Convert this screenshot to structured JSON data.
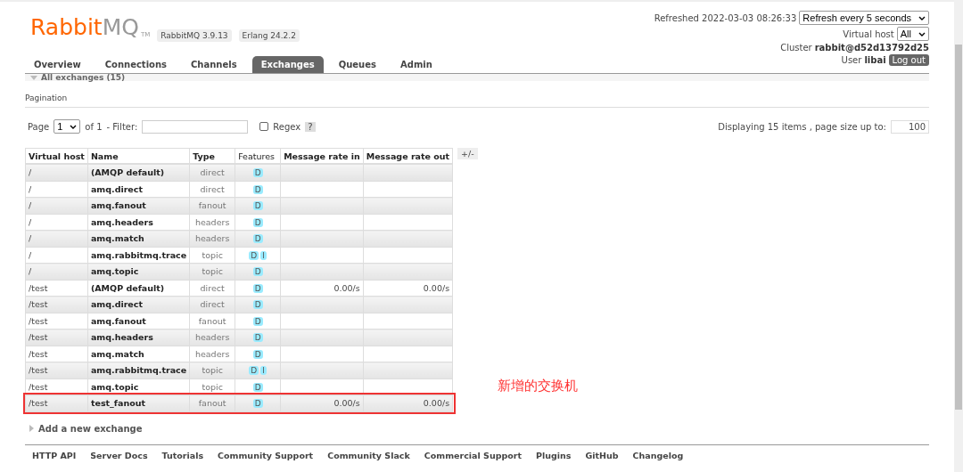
{
  "header": {
    "logo_text": {
      "brand": "Rabbit",
      "suffix": "MQ",
      "mark": "TM"
    },
    "badges": [
      "RabbitMQ 3.9.13",
      "Erlang 24.2.2"
    ],
    "refreshed_label": "Refreshed 2022-03-03 08:26:33",
    "refresh_select": "Refresh every 5 seconds",
    "vhost_label": "Virtual host",
    "vhost_select": "All",
    "cluster_label": "Cluster",
    "cluster_value": "rabbit@d52d13792d25",
    "user_label": "User",
    "user_value": "libai",
    "logout": "Log out"
  },
  "tabs": [
    {
      "label": "Overview",
      "selected": false
    },
    {
      "label": "Connections",
      "selected": false
    },
    {
      "label": "Channels",
      "selected": false
    },
    {
      "label": "Exchanges",
      "selected": true
    },
    {
      "label": "Queues",
      "selected": false
    },
    {
      "label": "Admin",
      "selected": false
    }
  ],
  "section": {
    "title": "All exchanges (15)",
    "expanded": true
  },
  "pagination": {
    "heading": "Pagination",
    "page_label": "Page",
    "page_select": "1",
    "of_label": "of 1",
    "filter_label": "- Filter:",
    "regex_label": "Regex",
    "regex_checked": false,
    "help": "?",
    "displaying": "Displaying 15 items , page size up to:",
    "page_size": "100"
  },
  "table": {
    "columns": [
      "Virtual host",
      "Name",
      "Type",
      "Features",
      "Message rate in",
      "Message rate out"
    ],
    "column_toggle": "+/-",
    "rows": [
      {
        "vhost": "/",
        "name": "(AMQP default)",
        "type": "direct",
        "features": [
          "D"
        ],
        "rate_in": "",
        "rate_out": "",
        "highlighted": false
      },
      {
        "vhost": "/",
        "name": "amq.direct",
        "type": "direct",
        "features": [
          "D"
        ],
        "rate_in": "",
        "rate_out": "",
        "highlighted": false
      },
      {
        "vhost": "/",
        "name": "amq.fanout",
        "type": "fanout",
        "features": [
          "D"
        ],
        "rate_in": "",
        "rate_out": "",
        "highlighted": false
      },
      {
        "vhost": "/",
        "name": "amq.headers",
        "type": "headers",
        "features": [
          "D"
        ],
        "rate_in": "",
        "rate_out": "",
        "highlighted": false
      },
      {
        "vhost": "/",
        "name": "amq.match",
        "type": "headers",
        "features": [
          "D"
        ],
        "rate_in": "",
        "rate_out": "",
        "highlighted": false
      },
      {
        "vhost": "/",
        "name": "amq.rabbitmq.trace",
        "type": "topic",
        "features": [
          "D",
          "I"
        ],
        "rate_in": "",
        "rate_out": "",
        "highlighted": false
      },
      {
        "vhost": "/",
        "name": "amq.topic",
        "type": "topic",
        "features": [
          "D"
        ],
        "rate_in": "",
        "rate_out": "",
        "highlighted": false
      },
      {
        "vhost": "/test",
        "name": "(AMQP default)",
        "type": "direct",
        "features": [
          "D"
        ],
        "rate_in": "0.00/s",
        "rate_out": "0.00/s",
        "highlighted": false
      },
      {
        "vhost": "/test",
        "name": "amq.direct",
        "type": "direct",
        "features": [
          "D"
        ],
        "rate_in": "",
        "rate_out": "",
        "highlighted": false
      },
      {
        "vhost": "/test",
        "name": "amq.fanout",
        "type": "fanout",
        "features": [
          "D"
        ],
        "rate_in": "",
        "rate_out": "",
        "highlighted": false
      },
      {
        "vhost": "/test",
        "name": "amq.headers",
        "type": "headers",
        "features": [
          "D"
        ],
        "rate_in": "",
        "rate_out": "",
        "highlighted": false
      },
      {
        "vhost": "/test",
        "name": "amq.match",
        "type": "headers",
        "features": [
          "D"
        ],
        "rate_in": "",
        "rate_out": "",
        "highlighted": false
      },
      {
        "vhost": "/test",
        "name": "amq.rabbitmq.trace",
        "type": "topic",
        "features": [
          "D",
          "I"
        ],
        "rate_in": "",
        "rate_out": "",
        "highlighted": false
      },
      {
        "vhost": "/test",
        "name": "amq.topic",
        "type": "topic",
        "features": [
          "D"
        ],
        "rate_in": "",
        "rate_out": "",
        "highlighted": false
      },
      {
        "vhost": "/test",
        "name": "test_fanout",
        "type": "fanout",
        "features": [
          "D"
        ],
        "rate_in": "0.00/s",
        "rate_out": "0.00/s",
        "highlighted": true
      }
    ]
  },
  "annotation": "新增的交换机",
  "add_section": {
    "title": "Add a new exchange",
    "expanded": false
  },
  "footer": [
    "HTTP API",
    "Server Docs",
    "Tutorials",
    "Community Support",
    "Community Slack",
    "Commercial Support",
    "Plugins",
    "GitHub",
    "Changelog"
  ]
}
